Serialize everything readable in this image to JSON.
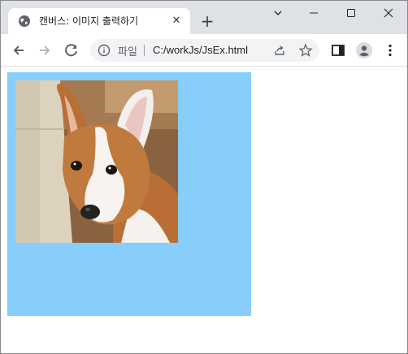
{
  "tab": {
    "title": "캔버스: 이미지 출력하기",
    "favicon": "globe-icon",
    "close_symbol": "✕"
  },
  "newtab_symbol": "+",
  "window_controls": {
    "menu": "chevron-down-icon",
    "minimize": "minimize-icon",
    "maximize": "maximize-icon",
    "close": "close-icon"
  },
  "toolbar": {
    "back": "back-arrow-icon",
    "forward": "forward-arrow-icon",
    "reload": "reload-icon",
    "info": "info-icon",
    "file_label": "파일",
    "url": "C:/workJs/JsEx.html",
    "share": "share-icon",
    "bookmark": "star-icon",
    "sidepanel": "side-panel-icon",
    "profile": "profile-icon",
    "menu": "more-vert-icon"
  },
  "canvas": {
    "background": "#87cefa",
    "image_alt": "corgi dog photo"
  }
}
